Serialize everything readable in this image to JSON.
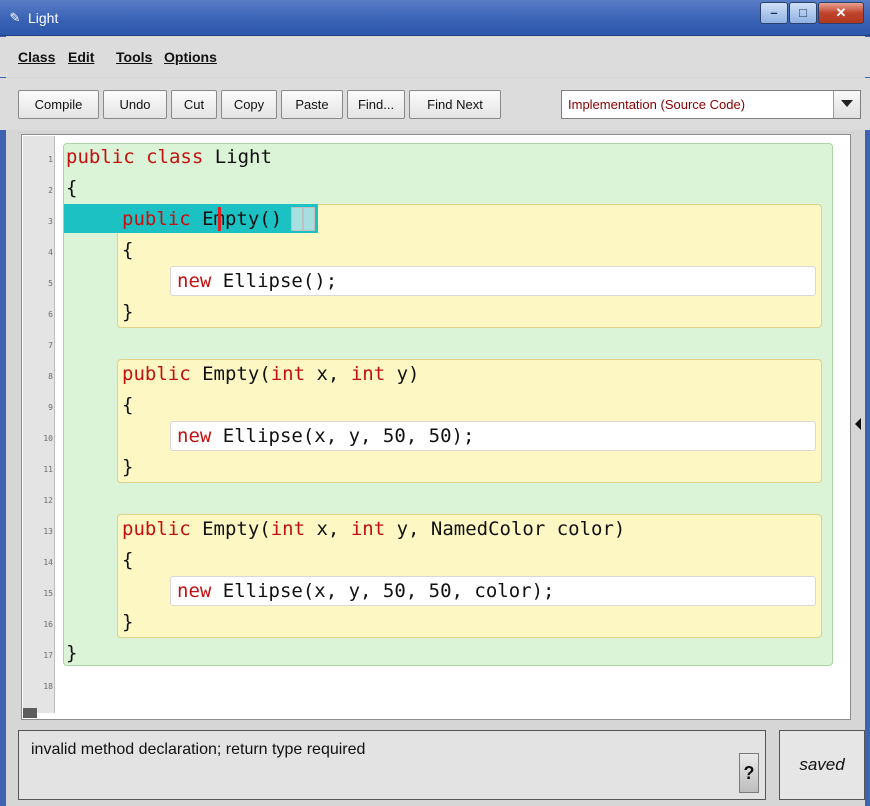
{
  "window": {
    "title": "Light",
    "icon": "bluej-bird-icon",
    "controls": [
      "minimize-icon",
      "maximize-icon",
      "close-icon"
    ]
  },
  "menubar": {
    "items": [
      "Class",
      "Edit",
      "Tools",
      "Options"
    ]
  },
  "toolbar": {
    "buttons": [
      "Compile",
      "Undo",
      "Cut",
      "Copy",
      "Paste",
      "Find...",
      "Find Next"
    ],
    "view_select": "Implementation (Source Code)"
  },
  "editor": {
    "line_numbers": [
      "1",
      "2",
      "3",
      "4",
      "5",
      "6",
      "7",
      "8",
      "9",
      "10",
      "11",
      "12",
      "13",
      "14",
      "15",
      "16",
      "17",
      "18"
    ],
    "colors": {
      "class_scope": "#dbf3d6",
      "method_scope": "#fdf8c3",
      "error_highlight": "#1cc2c3",
      "keyword": "#c41010"
    },
    "lines": {
      "l1_kw": "public class",
      "l1_rest": " Light",
      "l2": "{",
      "l3_kw": "public ",
      "l3_name": "Empty",
      "l3_p1": "(",
      "l3_p2": ")",
      "l4": "{",
      "l5_kw": "new",
      "l5_rest": " Ellipse();",
      "l6": "}",
      "l8_kw1": "public",
      "l8_a": " Empty(",
      "l8_kw2": "int",
      "l8_b": " x, ",
      "l8_kw3": "int",
      "l8_c": " y)",
      "l9": "{",
      "l10_kw": "new",
      "l10_rest": " Ellipse(x, y, 50, 50);",
      "l11": "}",
      "l13_kw1": "public",
      "l13_a": " Empty(",
      "l13_kw2": "int",
      "l13_b": " x, ",
      "l13_kw3": "int",
      "l13_c": " y, NamedColor color)",
      "l14": "{",
      "l15_kw": "new",
      "l15_rest": " Ellipse(x, y, 50, 50, color);",
      "l16": "}",
      "l17": "}"
    }
  },
  "status": {
    "message": "invalid method declaration; return type required",
    "help_label": "?",
    "saved_label": "saved"
  }
}
